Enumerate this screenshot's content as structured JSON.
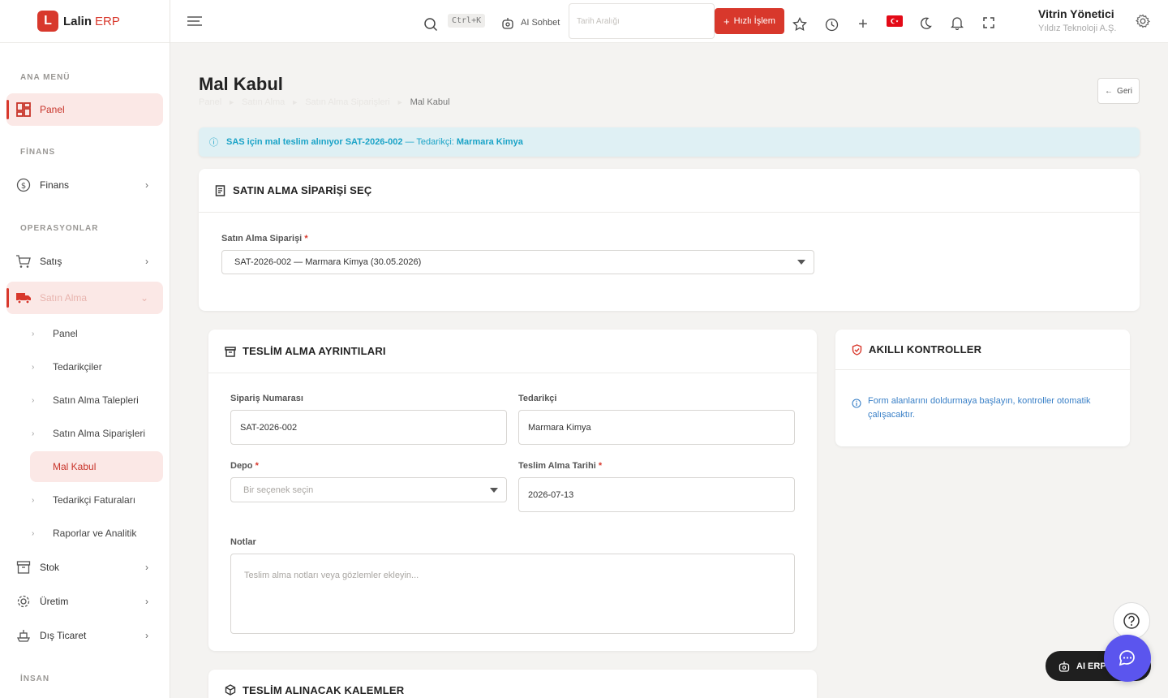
{
  "brand": {
    "logo_letter": "L",
    "name": "Lalin",
    "sub": "ERP"
  },
  "sidebar": {
    "sections": {
      "main": "ANA MENÜ",
      "finance": "FİNANS",
      "operations": "OPERASYONLAR",
      "hr": "İNSAN"
    },
    "items": {
      "panel": "Panel",
      "finans": "Finans",
      "satis": "Satış",
      "satin_alma": "Satın Alma",
      "stok": "Stok",
      "uretim": "Üretim",
      "dis_ticaret": "Dış Ticaret"
    },
    "sub_items": [
      "Panel",
      "Tedarikçiler",
      "Satın Alma Talepleri",
      "Satın Alma Siparişleri",
      "Mal Kabul",
      "Tedarikçi Faturaları",
      "Raporlar ve Analitik"
    ]
  },
  "topbar": {
    "shortcut": "Ctrl+K",
    "ai_chat": "AI Sohbet",
    "date_placeholder": "Tarih Aralığı",
    "quick_action": "Hızlı İşlem",
    "user_name": "Vitrin Yönetici",
    "user_company": "Yıldız Teknoloji A.Ş."
  },
  "page": {
    "title": "Mal Kabul",
    "breadcrumb": [
      "Panel",
      "Satın Alma",
      "Satın Alma Siparişleri",
      "Mal Kabul"
    ],
    "back_label": "Geri"
  },
  "alert": {
    "prefix": "SAS için mal teslim alınıyor SAT-2026-002",
    "middle": " — Tedarikçi: ",
    "supplier": "Marmara Kimya"
  },
  "order_select": {
    "title": "SATIN ALMA SİPARİŞİ SEÇ",
    "label": "Satın Alma Siparişi",
    "value": "SAT-2026-002 — Marmara Kimya (30.05.2026)"
  },
  "receipt": {
    "title": "TESLİM ALMA AYRINTILARI",
    "order_no_label": "Sipariş Numarası",
    "order_no_value": "SAT-2026-002",
    "supplier_label": "Tedarikçi",
    "supplier_value": "Marmara Kimya",
    "warehouse_label": "Depo",
    "warehouse_placeholder": "Bir seçenek seçin",
    "date_label": "Teslim Alma Tarihi",
    "date_value": "2026-07-13",
    "notes_label": "Notlar",
    "notes_placeholder": "Teslim alma notları veya gözlemler ekleyin..."
  },
  "smart": {
    "title": "AKILLI KONTROLLER",
    "info": "Form alanlarını doldurmaya başlayın, kontroller otomatik çalışacaktır."
  },
  "items_card": {
    "title": "TESLİM ALINACAK KALEMLER"
  },
  "ai_button": "AI ERP",
  "colors": {
    "accent": "#d8382c",
    "info": "#1aa3c7",
    "chat": "#5b55ee"
  }
}
